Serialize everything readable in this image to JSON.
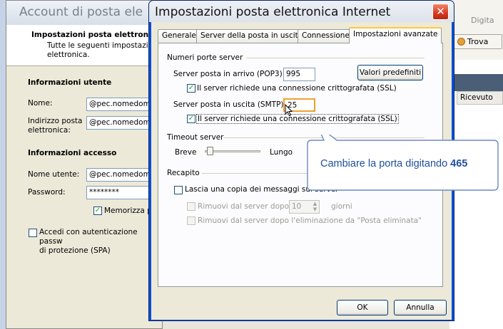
{
  "back_window": {
    "title": "Account di posta ele",
    "header_title": "Impostazioni posta elettronic",
    "header_desc": "Tutte le seguenti impostazioni\nelettronica.",
    "user_info_heading": "Informazioni utente",
    "name_label": "Nome:",
    "name_value": "@pec.nomedom",
    "email_label": "Indirizzo posta\nelettronica:",
    "email_value": "@pec.nomedom",
    "access_heading": "Informazioni accesso",
    "username_label": "Nome utente:",
    "username_value": "@pec.nomedom",
    "password_label": "Password:",
    "password_value": "********",
    "remember_label": "Memorizza pa",
    "spa_label": "Accedi con autenticazione passw\ndi protezione (SPA)"
  },
  "bg_app": {
    "digita_label": "Digita",
    "trova_label": "Trova",
    "ricevuto_header": "Ricevuto"
  },
  "dialog": {
    "title": "Impostazioni posta elettronica Internet",
    "tabs": [
      {
        "label": "Generale"
      },
      {
        "label": "Server della posta in uscita"
      },
      {
        "label": "Connessione"
      },
      {
        "label": "Impostazioni avanzate"
      }
    ],
    "ports_group": "Numeri porte server",
    "pop3_label": "Server posta in arrivo (POP3):",
    "pop3_value": "995",
    "defaults_button": "Valori predefiniti",
    "ssl_in_label": "Il server richiede una connessione crittografata (SSL)",
    "smtp_label": "Server posta in uscita (SMTP):",
    "smtp_value": "25",
    "ssl_out_label": "Il server richiede una connessione crittografata (SSL)",
    "timeout_group": "Timeout server",
    "timeout_short": "Breve",
    "timeout_long": "Lungo",
    "delivery_group": "Recapito",
    "keep_copy_label": "Lascia una copia dei messaggi sul server",
    "remove_after_label": "Rimuovi dal server dopo",
    "days_value": "10",
    "days_label": "giorni",
    "remove_deleted_label": "Rimuovi dal server dopo l'eliminazione da \"Posta eliminata\"",
    "ok_button": "OK",
    "cancel_button": "Annulla"
  },
  "callout": {
    "text": "Cambiare la porta digitando",
    "bold": "465"
  },
  "colors": {
    "callout_text": "#1f4e9c",
    "title_bar": "#0a5fe0",
    "close_red": "#d93a21",
    "highlight_orange": "#f0a030"
  },
  "timeout_level": 0.05
}
